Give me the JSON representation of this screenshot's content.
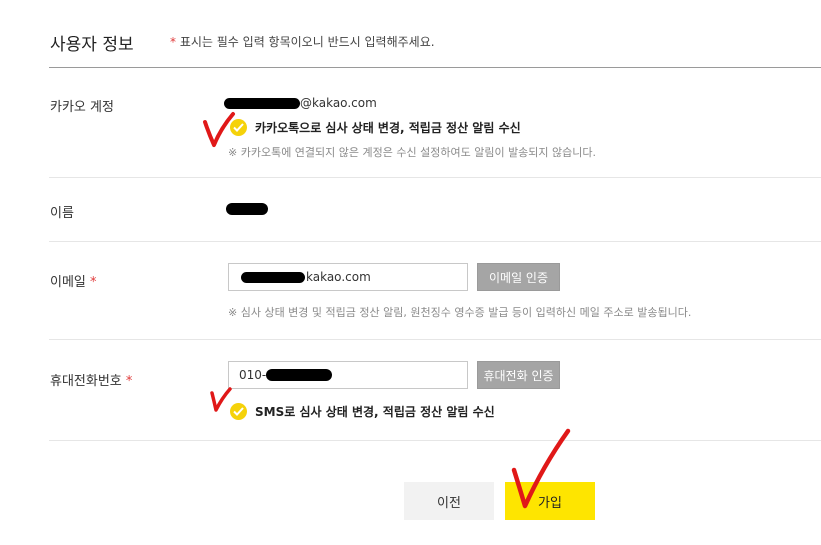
{
  "header": {
    "title": "사용자 정보",
    "required_star": "*",
    "required_notice": "표시는 필수 입력 항목이오니 반드시 입력해주세요."
  },
  "kakao_account": {
    "label": "카카오 계정",
    "email_suffix": "@kakao.com",
    "consent_label": "카카오톡으로 심사 상태 변경, 적립금 정산 알림 수신",
    "consent_checked": true,
    "note": "※ 카카오톡에 연결되지 않은 계정은 수신 설정하여도 알림이 발송되지 않습니다."
  },
  "name": {
    "label": "이름"
  },
  "email": {
    "label": "이메일",
    "required_star": "*",
    "value_suffix": "kakao.com",
    "verify_button": "이메일 인증",
    "note": "※ 심사 상태 변경 및 적립금 정산 알림, 원천징수 영수증 발급 등이 입력하신 메일 주소로 발송됩니다."
  },
  "phone": {
    "label": "휴대전화번호",
    "required_star": "*",
    "value_prefix": "010-",
    "verify_button": "휴대전화 인증",
    "consent_label": "SMS로 심사 상태 변경, 적립금 정산 알림 수신",
    "consent_checked": true
  },
  "actions": {
    "prev_button": "이전",
    "join_button": "가입"
  },
  "colors": {
    "accent_yellow": "#fee500",
    "check_yellow": "#f5d20a",
    "required_red": "#e03a3a",
    "annotation_red": "#e01818",
    "verify_button_gray": "#a5a5a5"
  }
}
